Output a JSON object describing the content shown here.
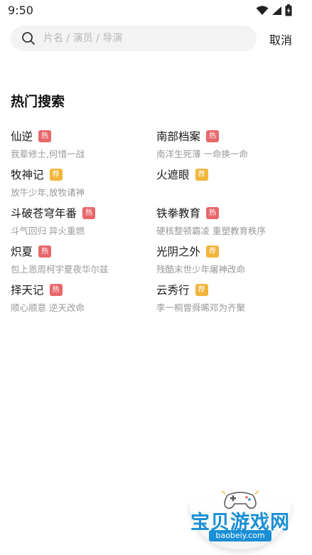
{
  "status_bar": {
    "time": "9:50",
    "icons": [
      "wifi-icon",
      "signal-icon",
      "battery-charging-icon"
    ]
  },
  "search": {
    "placeholder": "片名 / 演员 / 导演",
    "value": "",
    "cancel_label": "取消"
  },
  "hot_search": {
    "title": "热门搜索",
    "items": [
      {
        "title": "仙逆",
        "badge": "热",
        "badge_type": "hot",
        "desc": "我辈修士,何惜一战"
      },
      {
        "title": "南部档案",
        "badge": "热",
        "badge_type": "hot",
        "desc": "南洋生死薄 一命换一命"
      },
      {
        "title": "牧神记",
        "badge": "荐",
        "badge_type": "rec",
        "desc": "放牛少年,放牧诸神"
      },
      {
        "title": "火遮眼",
        "badge": "荐",
        "badge_type": "rec",
        "desc": ""
      },
      {
        "title": "斗破苍穹年番",
        "badge": "热",
        "badge_type": "hot",
        "desc": "斗气回归 异火重燃"
      },
      {
        "title": "铁拳教育",
        "badge": "热",
        "badge_type": "hot",
        "desc": "硬核整顿霸凌 重塑教育秩序"
      },
      {
        "title": "炽夏",
        "badge": "热",
        "badge_type": "hot",
        "desc": "包上恩周柯宇夏夜华尔兹"
      },
      {
        "title": "光阴之外",
        "badge": "荐",
        "badge_type": "rec",
        "desc": "残酷末世少年屠神改命"
      },
      {
        "title": "择天记",
        "badge": "热",
        "badge_type": "hot",
        "desc": "顺心顺意 逆天改命"
      },
      {
        "title": "云秀行",
        "badge": "荐",
        "badge_type": "rec",
        "desc": "李一桐曾舜晞邓为齐聚"
      }
    ]
  },
  "colors": {
    "badge_hot": "#e8676b",
    "badge_rec": "#f2b53c",
    "watermark_blue": "#1a8fd6"
  },
  "watermark": {
    "text": "宝贝游戏网",
    "url": "baobeiy.com"
  }
}
